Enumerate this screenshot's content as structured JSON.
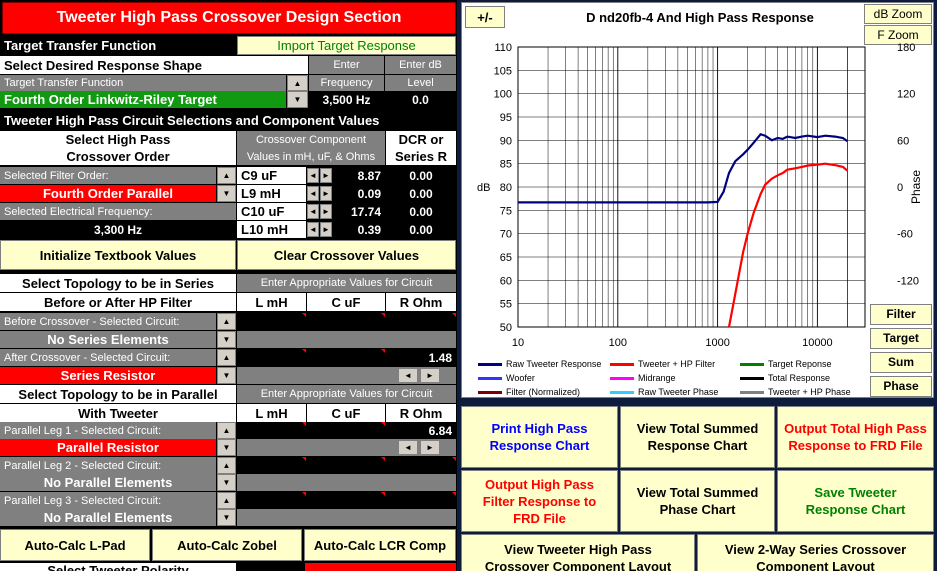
{
  "title": "Tweeter High Pass Crossover Design Section",
  "target": {
    "header": "Target Transfer Function",
    "import_btn": "Import Target Response",
    "select_shape": "Select Desired Response Shape",
    "enter": "Enter",
    "enter_db": "Enter dB",
    "tf_label": "Target Transfer Function",
    "frequency": "Frequency",
    "level": "Level",
    "selected": "Fourth Order Linkwitz-Riley Target",
    "freq_value": "3,500 Hz",
    "level_value": "0.0"
  },
  "circuit": {
    "header": "Tweeter High Pass Circuit Selections and Component Values",
    "select_order_1": "Select High Pass",
    "select_order_2": "Crossover Order",
    "comp_header_1": "Crossover Component",
    "comp_header_2": "Values in mH, uF, & Ohms",
    "dcr_1": "DCR or",
    "dcr_2": "Series R",
    "filter_order_label": "Selected Filter Order:",
    "filter_order": "Fourth Order Parallel",
    "freq_label": "Selected Electrical Frequency:",
    "freq": "3,300 Hz",
    "components": [
      {
        "name": "C9  uF",
        "value": "8.87",
        "dcr": "0.00"
      },
      {
        "name": "L9 mH",
        "value": "0.09",
        "dcr": "0.00"
      },
      {
        "name": "C10  uF",
        "value": "17.74",
        "dcr": "0.00"
      },
      {
        "name": "L10 mH",
        "value": "0.39",
        "dcr": "0.00"
      }
    ],
    "init_btn": "Initialize Textbook Values",
    "clear_btn": "Clear Crossover Values"
  },
  "series": {
    "title_1": "Select Topology to be in Series",
    "title_2": "Before or After HP Filter",
    "enter_values": "Enter Appropriate Values for Circuit",
    "col_l": "L mH",
    "col_c": "C uF",
    "col_r": "R Ohm",
    "before_label": "Before Crossover - Selected Circuit:",
    "before_value": "No Series Elements",
    "after_label": "After Crossover - Selected Circuit:",
    "after_value": "Series Resistor",
    "after_r": "1.48"
  },
  "parallel": {
    "title_1": "Select Topology to be in Parallel",
    "title_2": "With Tweeter",
    "enter_values": "Enter Appropriate Values for Circuit",
    "col_l": "L mH",
    "col_c": "C uF",
    "col_r": "R Ohm",
    "leg1_label": "Parallel Leg 1 - Selected Circuit:",
    "leg1_value": "Parallel Resistor",
    "leg1_r": "6.84",
    "leg2_label": "Parallel Leg 2 - Selected Circuit:",
    "leg2_value": "No Parallel Elements",
    "leg3_label": "Parallel Leg 3 - Selected Circuit:",
    "leg3_value": "No Parallel Elements"
  },
  "bottom_buttons": [
    "Auto-Calc L-Pad",
    "Auto-Calc Zobel",
    "Auto-Calc LCR Comp"
  ],
  "cut_off_text": "Select Tweeter Polarity",
  "chart": {
    "plusminus": "+/-",
    "title": "D nd20fb-4  And High Pass Response",
    "db_zoom": "dB Zoom",
    "f_zoom": "F Zoom",
    "side_buttons": [
      "Filter",
      "Target",
      "Sum",
      "Phase"
    ],
    "y_left_label": "dB",
    "y_right_label": "Phase"
  },
  "chart_data": {
    "type": "line",
    "title": "D nd20fb-4  And High Pass Response",
    "xlabel": "",
    "ylabel": "dB",
    "y2label": "Phase",
    "x_scale": "log",
    "xlim": [
      10,
      30000
    ],
    "ylim": [
      50,
      110
    ],
    "y2lim": [
      -180,
      180
    ],
    "x_ticks": [
      "10",
      "100",
      "1000",
      "10000"
    ],
    "y_ticks": [
      "110",
      "105",
      "100",
      "95",
      "90",
      "85",
      "80",
      "75",
      "70",
      "65",
      "60",
      "55",
      "50"
    ],
    "y2_ticks": [
      "180",
      "120",
      "60",
      "0",
      "-60",
      "-120"
    ],
    "grid": true,
    "series": [
      {
        "name": "Raw Tweeter Response",
        "color": "#000080",
        "x": [
          10,
          100,
          800,
          1000,
          1150,
          1300,
          1500,
          1800,
          2000,
          2300,
          2700,
          3000,
          3500,
          4000,
          4500,
          5000,
          6000,
          7000,
          8000,
          10000,
          12000,
          15000,
          18000,
          20000
        ],
        "y": [
          76.7,
          76.7,
          76.7,
          76.8,
          79,
          83,
          85.5,
          87,
          88,
          89.5,
          91.3,
          91,
          90,
          90.5,
          90.3,
          90.8,
          90.5,
          90.8,
          91,
          90.7,
          91,
          90.8,
          90.5,
          89.8
        ]
      },
      {
        "name": "Tweeter + HP Filter",
        "color": "#ff0000",
        "x": [
          1300,
          1500,
          1800,
          2000,
          2300,
          2700,
          3000,
          3500,
          4000,
          4500,
          5000,
          6000,
          7000,
          8000,
          10000,
          12000,
          15000,
          18000,
          20000
        ],
        "y": [
          50,
          57,
          66,
          70,
          74.5,
          78.5,
          80.5,
          81.8,
          82.5,
          83,
          83.7,
          84,
          84.3,
          84.6,
          84.8,
          85,
          84.7,
          84.3,
          83.5
        ]
      }
    ],
    "legend": [
      "Raw Tweeter Response",
      "Tweeter + HP Filter",
      "Target Reponse",
      "Woofer",
      "Midrange",
      "Total Response",
      "Filter (Normalized)",
      "Raw Tweeter Phase",
      "Tweeter + HP Phase"
    ],
    "legend_colors": [
      "#000080",
      "#ff0000",
      "#008000",
      "#3333ff",
      "#ff00ff",
      "#000000",
      "#800000",
      "#33ccff",
      "#808080"
    ]
  },
  "right_buttons": [
    {
      "label": "Print High Pass Response Chart",
      "color": "#0000ff"
    },
    {
      "label": "View Total Summed Response Chart",
      "color": "#000000"
    },
    {
      "label": "Output Total High Pass Response to FRD File",
      "color": "#ff0000"
    },
    {
      "label": "Output High Pass Filter Response to FRD File",
      "color": "#ff0000"
    },
    {
      "label": "View Total Summed Phase Chart",
      "color": "#000000"
    },
    {
      "label": "Save Tweeter Response Chart",
      "color": "#008000"
    },
    {
      "label": "View Tweeter High Pass Crossover Component Layout",
      "color": "#000000"
    },
    {
      "label": "View 2-Way Series Crossover Component Layout",
      "color": "#000000"
    }
  ]
}
